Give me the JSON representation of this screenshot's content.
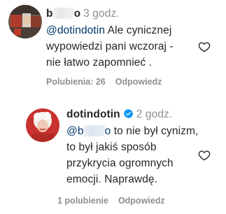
{
  "comment1": {
    "username": "b",
    "username_suffix": "o",
    "time": "3 godz.",
    "mention": "@dotindotin",
    "lines": [
      "Ale cynicznej",
      "wypowiedzi pani wczoraj -",
      "nie łatwo zapomnieć ."
    ],
    "likes": "Polubienia: 26",
    "reply": "Odpowiedz"
  },
  "comment2": {
    "username": "dotindotin",
    "time": "2 godz.",
    "mention_prefix": "@b",
    "mention_suffix": "o",
    "lines": [
      "to nie był cynizm,",
      "to był jakiś sposób",
      "przykrycia ogromnych",
      "emocji. Naprawdę."
    ],
    "likes": "1 polubienie",
    "reply": "Odpowiedz"
  },
  "colors": {
    "text": "#262626",
    "muted": "#8e8e8e",
    "mention": "#00376b",
    "verified": "#0095f6"
  },
  "icons": {
    "like": "heart-outline-icon",
    "verified": "verified-badge-icon"
  }
}
